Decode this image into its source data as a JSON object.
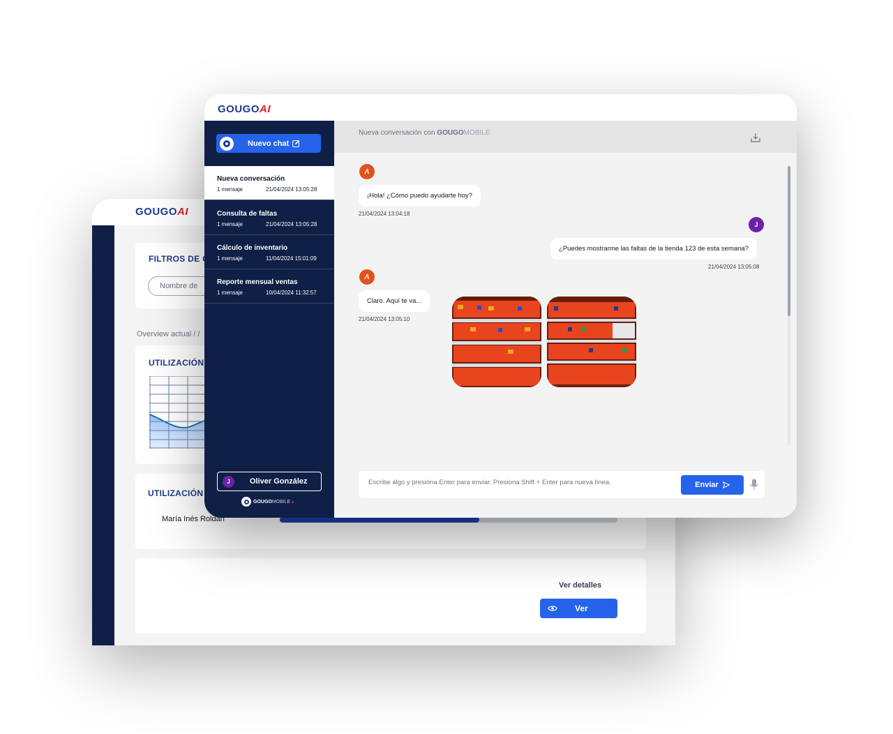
{
  "dashboard": {
    "logo": {
      "text": "GOUGO",
      "ai": "AI"
    },
    "filters_title": "FILTROS DE C",
    "filter_placeholder": "Nombre de",
    "breadcrumb": "Overview actual / /",
    "card1_title": "UTILIZACIÓN",
    "card2_title": "UTILIZACIÓN",
    "person_name": "María Inés Roldán",
    "person_progress": 0.59,
    "ver_detalles": "Ver detalles",
    "ver_button": "Ver"
  },
  "chat": {
    "logo": {
      "text": "GOUGO",
      "ai": "AI"
    },
    "new_chat_label": "Nuevo chat",
    "conversations": [
      {
        "title": "Nueva conversación",
        "count": "1 mensaje",
        "date": "21/04/2024 13:05:28",
        "active": true
      },
      {
        "title": "Consulta de faltas",
        "count": "1 mensaje",
        "date": "21/04/2024 13:05:28",
        "active": false
      },
      {
        "title": "Cálculo de inventario",
        "count": "1 mensaje",
        "date": "11/04/2024 15:01:09",
        "active": false
      },
      {
        "title": "Reporte mensual ventas",
        "count": "1 mensaje",
        "date": "10/04/2024 11:32:57",
        "active": false
      }
    ],
    "user": {
      "initial": "J",
      "name": "Oliver González"
    },
    "footer_logo": {
      "gougo": "GOUGO",
      "mobile": "MOBILE"
    },
    "header": {
      "prefix": "Nueva conversación con",
      "brand": "GOUGO",
      "mobile": "MOBILE"
    },
    "messages": [
      {
        "from": "bot",
        "text": "¡Hola! ¿Cómo puedo ayudarte hoy?",
        "time": "21/04/2024 13:04:18"
      },
      {
        "from": "user",
        "initial": "J",
        "text": "¿Puedes mostrarme las faltas de la tienda 123 de esta semana?",
        "time": "21/04/2024 13:05:08"
      },
      {
        "from": "bot",
        "text": "Claro. Aquí te va...",
        "time": "21/04/2024 13:05:10"
      }
    ],
    "input_placeholder": "Escribe algo y presiona Enter para enviar. Presiona Shift + Enter para nueva línea.",
    "send_label": "Enviar",
    "colors": {
      "navy": "#0f1f45",
      "accent": "#2563eb",
      "bot": "#e2521c",
      "user": "#6b21a8"
    },
    "icons": [
      "edit-icon",
      "download-icon",
      "send-icon",
      "mic-icon",
      "eye-icon"
    ]
  }
}
